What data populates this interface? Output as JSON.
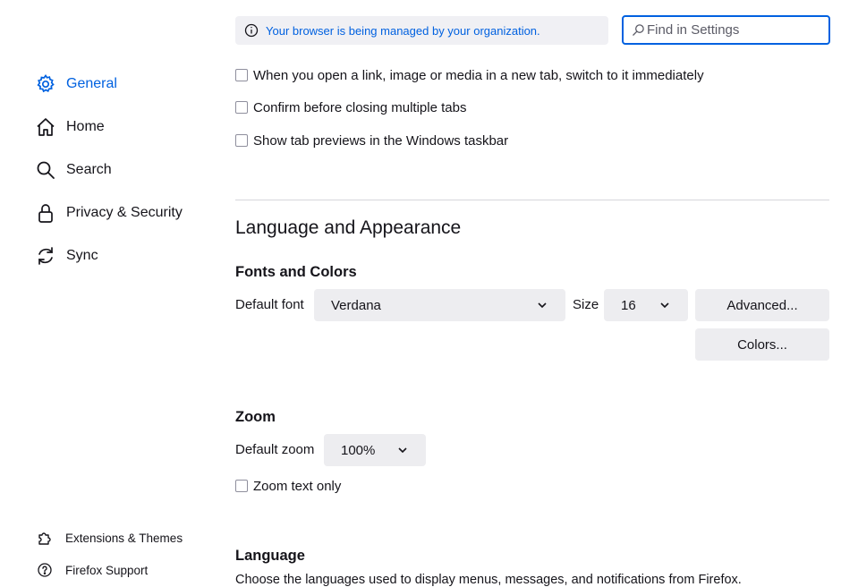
{
  "banner": {
    "text": "Your browser is being managed by your organization.",
    "icon": "info-icon"
  },
  "search": {
    "placeholder": "Find in Settings",
    "value": ""
  },
  "sidebar": {
    "items": [
      {
        "label": "General",
        "icon": "gear-icon",
        "active": true
      },
      {
        "label": "Home",
        "icon": "home-icon"
      },
      {
        "label": "Search",
        "icon": "search-icon"
      },
      {
        "label": "Privacy & Security",
        "icon": "lock-icon"
      },
      {
        "label": "Sync",
        "icon": "sync-icon"
      }
    ],
    "footer": [
      {
        "label": "Extensions & Themes",
        "icon": "puzzle-icon"
      },
      {
        "label": "Firefox Support",
        "icon": "help-icon"
      }
    ]
  },
  "tabs_options": [
    {
      "label": "When you open a link, image or media in a new tab, switch to it immediately",
      "checked": false
    },
    {
      "label": "Confirm before closing multiple tabs",
      "checked": false
    },
    {
      "label": "Show tab previews in the Windows taskbar",
      "checked": false
    }
  ],
  "language_appearance": {
    "heading": "Language and Appearance",
    "fonts": {
      "heading": "Fonts and Colors",
      "default_font_label": "Default font",
      "default_font_value": "Verdana",
      "size_label": "Size",
      "size_value": "16",
      "advanced_button": "Advanced...",
      "colors_button": "Colors..."
    },
    "zoom": {
      "heading": "Zoom",
      "default_zoom_label": "Default zoom",
      "default_zoom_value": "100%",
      "zoom_text_only_label": "Zoom text only",
      "zoom_text_only_checked": false
    },
    "language": {
      "heading": "Language",
      "description": "Choose the languages used to display menus, messages, and notifications from Firefox."
    }
  },
  "colors": {
    "accent": "#0061e0",
    "text": "#15141a",
    "button_bg": "#ededf0",
    "banner_bg": "#f0f0f4"
  }
}
